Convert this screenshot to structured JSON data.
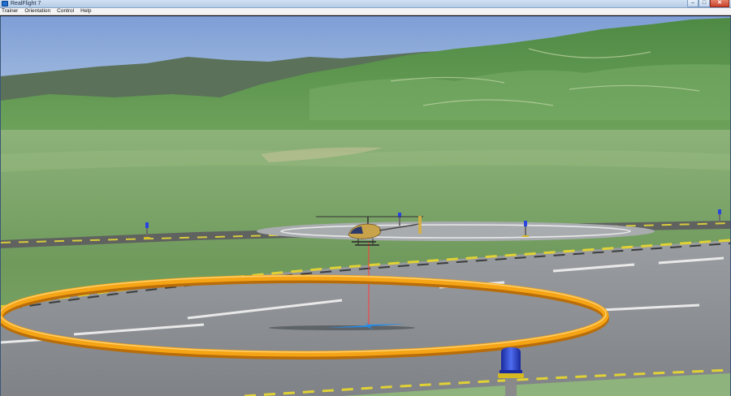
{
  "window": {
    "title": "RealFlight 7",
    "minimize_icon": "minimize-icon",
    "maximize_icon": "maximize-icon",
    "close_icon": "close-icon",
    "min_glyph": "–",
    "max_glyph": "□",
    "close_glyph": "✕"
  },
  "menu": {
    "items": [
      {
        "label": "Trainer"
      },
      {
        "label": "Orientation"
      },
      {
        "label": "Control"
      },
      {
        "label": "Help"
      }
    ]
  },
  "scene": {
    "colors": {
      "sky_top": "#7e9ed6",
      "sky_bottom": "#b9cde3",
      "hills_far": "#5b7159",
      "hills_near": "#4c8b45",
      "field": "#7aa36a",
      "runway": "#8c8f93",
      "ring": "#f5a416",
      "beacon": "#2740d8"
    },
    "objects": [
      "mountains",
      "grass-field",
      "runway",
      "helipad",
      "helicopter",
      "training-ring",
      "beacon-lights",
      "landing-marker"
    ]
  }
}
